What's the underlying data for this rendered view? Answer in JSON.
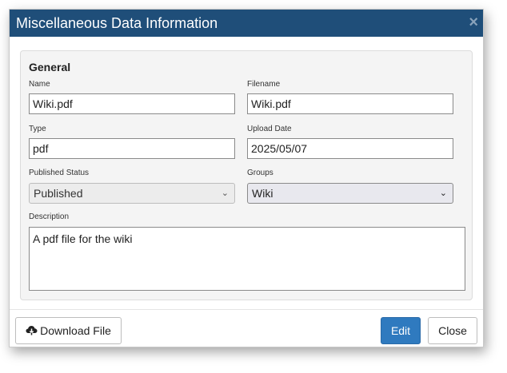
{
  "dialog": {
    "title": "Miscellaneous Data Information",
    "close_glyph": "×"
  },
  "general": {
    "section_title": "General",
    "name_label": "Name",
    "name_value": "Wiki.pdf",
    "filename_label": "Filename",
    "filename_value": "Wiki.pdf",
    "type_label": "Type",
    "type_value": "pdf",
    "upload_date_label": "Upload Date",
    "upload_date_value": "2025/05/07",
    "published_status_label": "Published Status",
    "published_status_value": "Published",
    "groups_label": "Groups",
    "groups_value": "Wiki",
    "description_label": "Description",
    "description_value": "A pdf file for the wiki"
  },
  "footer": {
    "download_label": "Download File",
    "download_icon": "cloud-download-icon",
    "edit_label": "Edit",
    "close_label": "Close"
  },
  "colors": {
    "titlebar": "#1f4e79",
    "primary_button": "#2f7abf"
  }
}
